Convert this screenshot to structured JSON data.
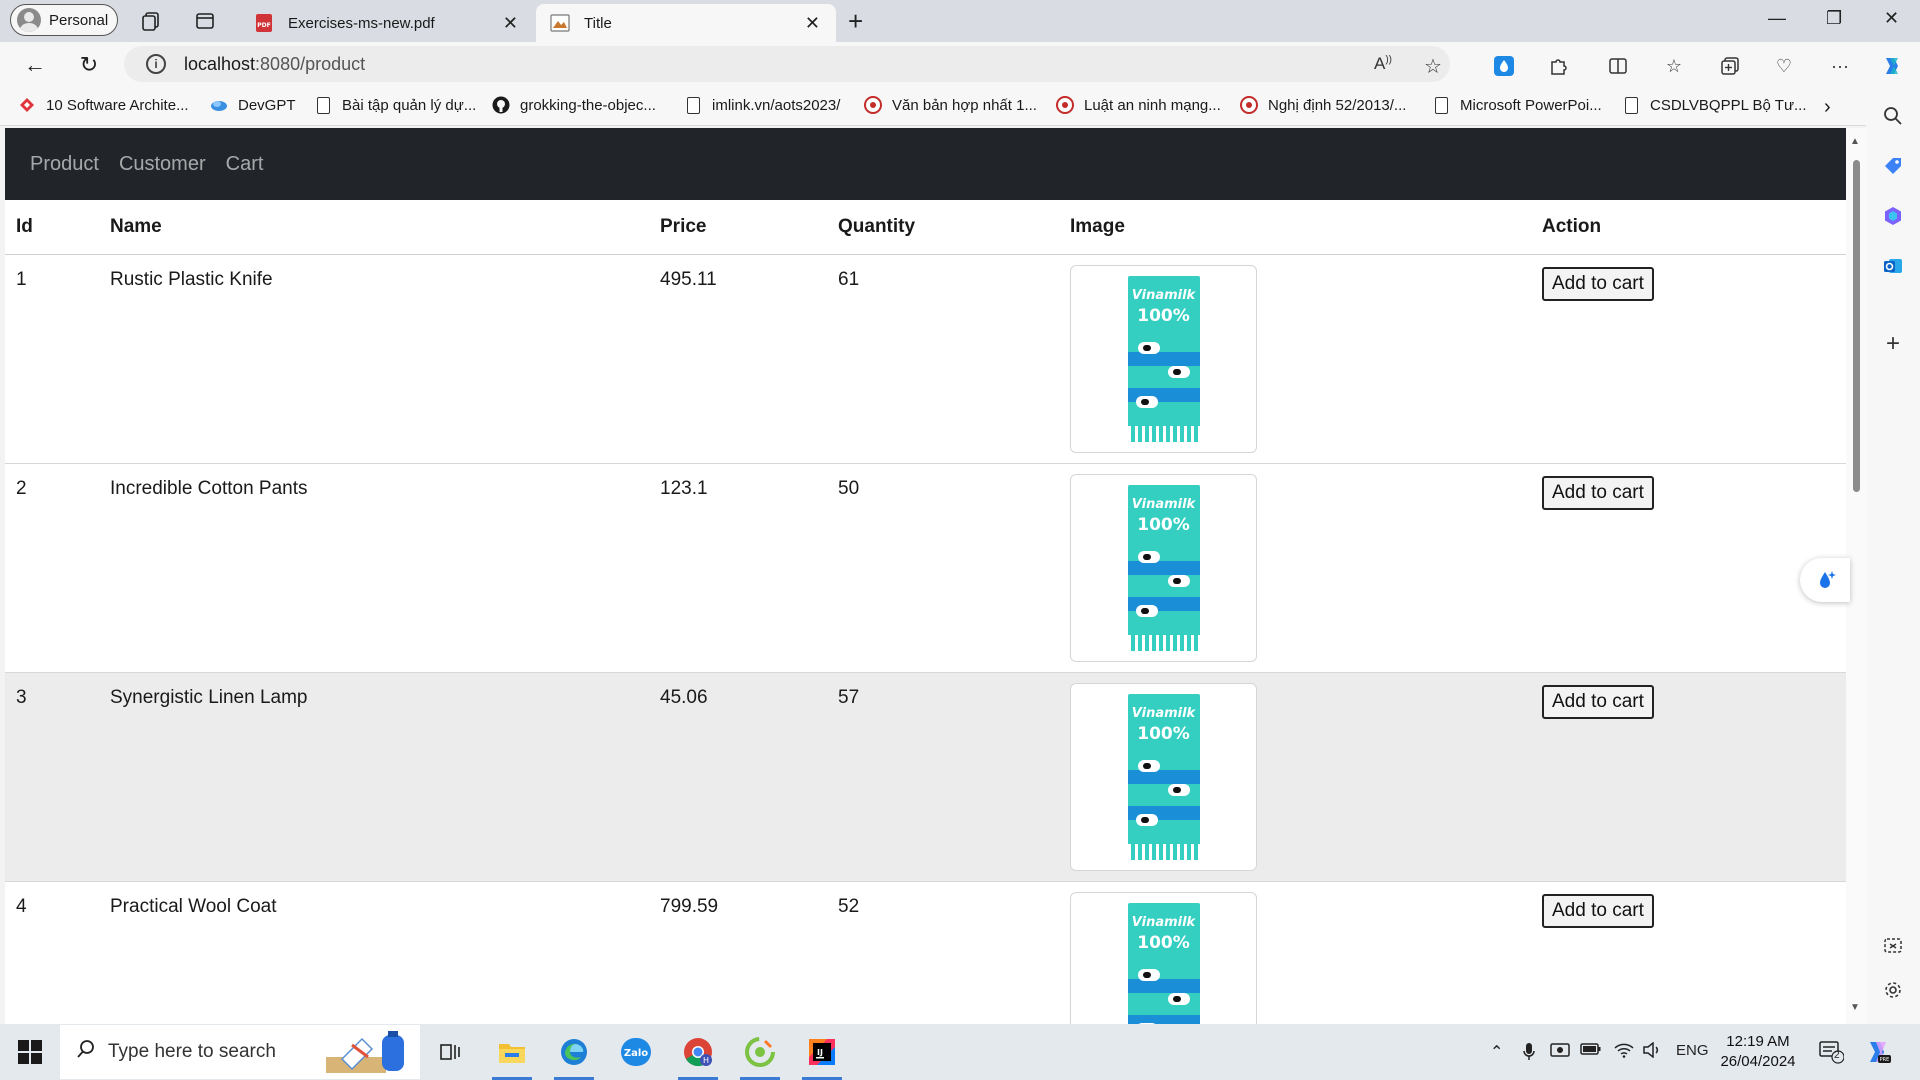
{
  "browser": {
    "profile_label": "Personal",
    "tabs": [
      {
        "title": "Exercises-ms-new.pdf",
        "icon": "pdf-icon"
      },
      {
        "title": "Title",
        "icon": "page-favicon"
      }
    ],
    "url_host": "localhost",
    "url_path": ":8080/product",
    "bookmarks": [
      {
        "label": "10 Software Archite...",
        "icon": "red-diamond-icon"
      },
      {
        "label": "DevGPT",
        "icon": "devgpt-icon"
      },
      {
        "label": "Bài tập quản lý dự...",
        "icon": "document-icon"
      },
      {
        "label": "grokking-the-objec...",
        "icon": "github-icon"
      },
      {
        "label": "imlink.vn/aots2023/",
        "icon": "document-icon"
      },
      {
        "label": "Văn bản hợp nhất 1...",
        "icon": "red-seal-icon"
      },
      {
        "label": "Luật an ninh mạng...",
        "icon": "red-seal-icon"
      },
      {
        "label": "Nghị định 52/2013/...",
        "icon": "red-seal-icon"
      },
      {
        "label": "Microsoft PowerPoi...",
        "icon": "document-icon"
      },
      {
        "label": "CSDLVBQPPL Bộ Tư...",
        "icon": "document-icon"
      }
    ]
  },
  "app": {
    "nav": [
      "Product",
      "Customer",
      "Cart"
    ],
    "table": {
      "headers": [
        "Id",
        "Name",
        "Price",
        "Quantity",
        "Image",
        "Action"
      ],
      "rows": [
        {
          "id": "1",
          "name": "Rustic Plastic Knife",
          "price": "495.11",
          "quantity": "61",
          "action": "Add to cart"
        },
        {
          "id": "2",
          "name": "Incredible Cotton Pants",
          "price": "123.1",
          "quantity": "50",
          "action": "Add to cart"
        },
        {
          "id": "3",
          "name": "Synergistic Linen Lamp",
          "price": "45.06",
          "quantity": "57",
          "action": "Add to cart"
        },
        {
          "id": "4",
          "name": "Practical Wool Coat",
          "price": "799.59",
          "quantity": "52",
          "action": "Add to cart"
        }
      ]
    },
    "product_image": {
      "brand": "Vinamilk",
      "badge": "100%",
      "color": "#34cfc1"
    }
  },
  "taskbar": {
    "search_placeholder": "Type here to search",
    "zalo_label": "Zalo",
    "language": "ENG",
    "time": "12:19 AM",
    "date": "26/04/2024",
    "notification_count": "2"
  }
}
